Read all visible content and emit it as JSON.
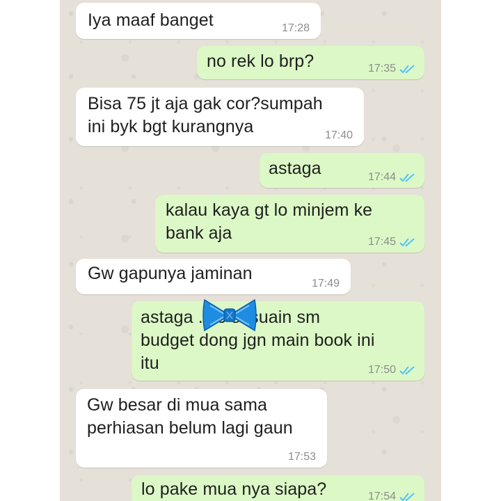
{
  "chat": {
    "messages": [
      {
        "text": "Iya maaf banget",
        "time": "17:28",
        "direction": "incoming"
      },
      {
        "text": "no rek lo brp?",
        "time": "17:35",
        "direction": "outgoing",
        "status": "read"
      },
      {
        "text": "Bisa 75 jt aja gak cor?sumpah\nini byk bgt kurangnya",
        "time": "17:40",
        "direction": "incoming"
      },
      {
        "text": "astaga",
        "time": "17:44",
        "direction": "outgoing",
        "status": "read"
      },
      {
        "text": "kalau kaya gt lo minjem ke\nbank aja",
        "time": "17:45",
        "direction": "outgoing",
        "status": "read"
      },
      {
        "text": "Gw gapunya jaminan",
        "time": "17:49",
        "direction": "incoming"
      },
      {
        "text": "astaga             ...lo sesuain sm\nbudget dong jgn main book ini\nitu",
        "time": "17:50",
        "direction": "outgoing",
        "status": "read"
      },
      {
        "text": "Gw besar di mua sama\nperhiasan belum lagi gaun",
        "time": "17:53",
        "direction": "incoming"
      },
      {
        "text": "lo pake mua nya siapa?",
        "time": "17:54",
        "direction": "outgoing",
        "status": "read"
      }
    ]
  },
  "colors": {
    "incoming_bubble": "#ffffff",
    "outgoing_bubble": "#dcf8c6",
    "read_ticks": "#4fc3f7",
    "chat_background": "#e6e1d8",
    "bow_sticker": "#1e8ce0"
  },
  "icons": {
    "read_receipt": "double-check-icon",
    "sticker": "bow-tie-sticker"
  }
}
